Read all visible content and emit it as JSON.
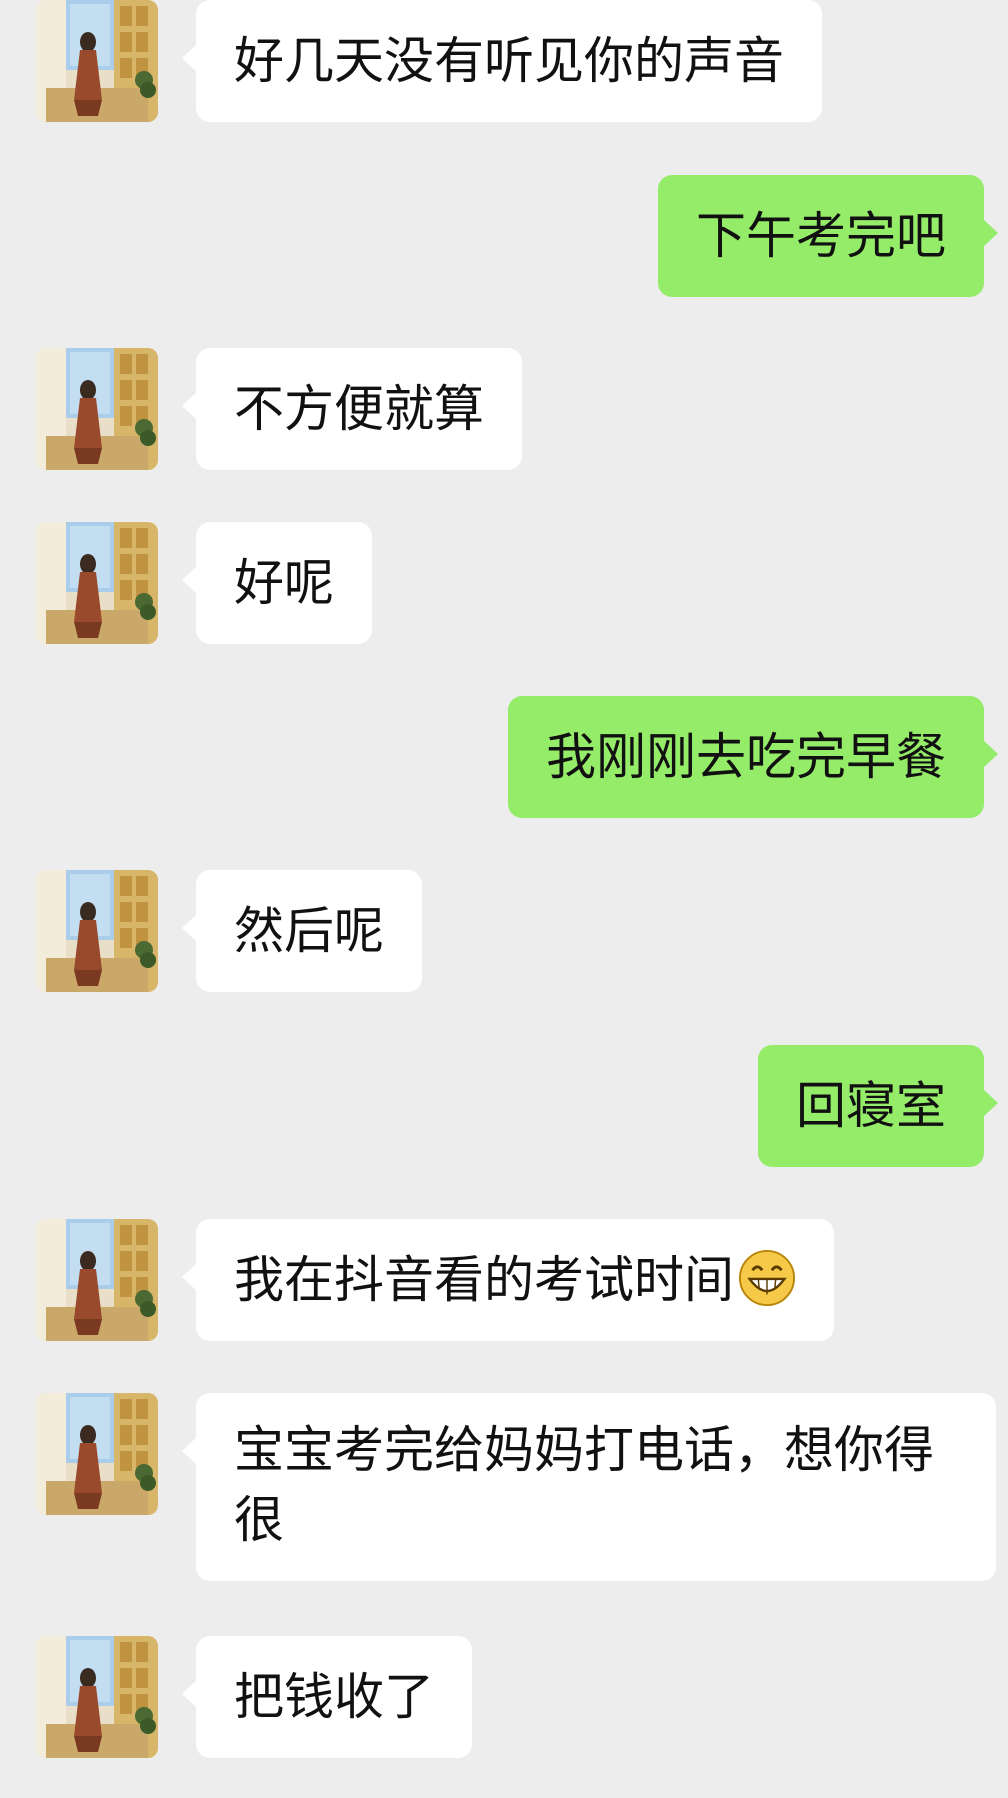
{
  "messages": [
    {
      "side": "in",
      "text": "好几天没有听见你的声音"
    },
    {
      "side": "out",
      "text": "下午考完吧"
    },
    {
      "side": "in",
      "text": "不方便就算"
    },
    {
      "side": "in",
      "text": "好呢"
    },
    {
      "side": "out",
      "text": "我刚刚去吃完早餐"
    },
    {
      "side": "in",
      "text": "然后呢"
    },
    {
      "side": "out",
      "text": "回寝室"
    },
    {
      "side": "in",
      "text": "我在抖音看的考试时间",
      "emoji": "grinning-face-icon"
    },
    {
      "side": "in",
      "text": "宝宝考完给妈妈打电话，想你得很"
    },
    {
      "side": "in",
      "text": "把钱收了"
    }
  ],
  "colors": {
    "background": "#ededed",
    "incoming_bubble": "#ffffff",
    "outgoing_bubble": "#95ec69",
    "text": "#111111"
  }
}
